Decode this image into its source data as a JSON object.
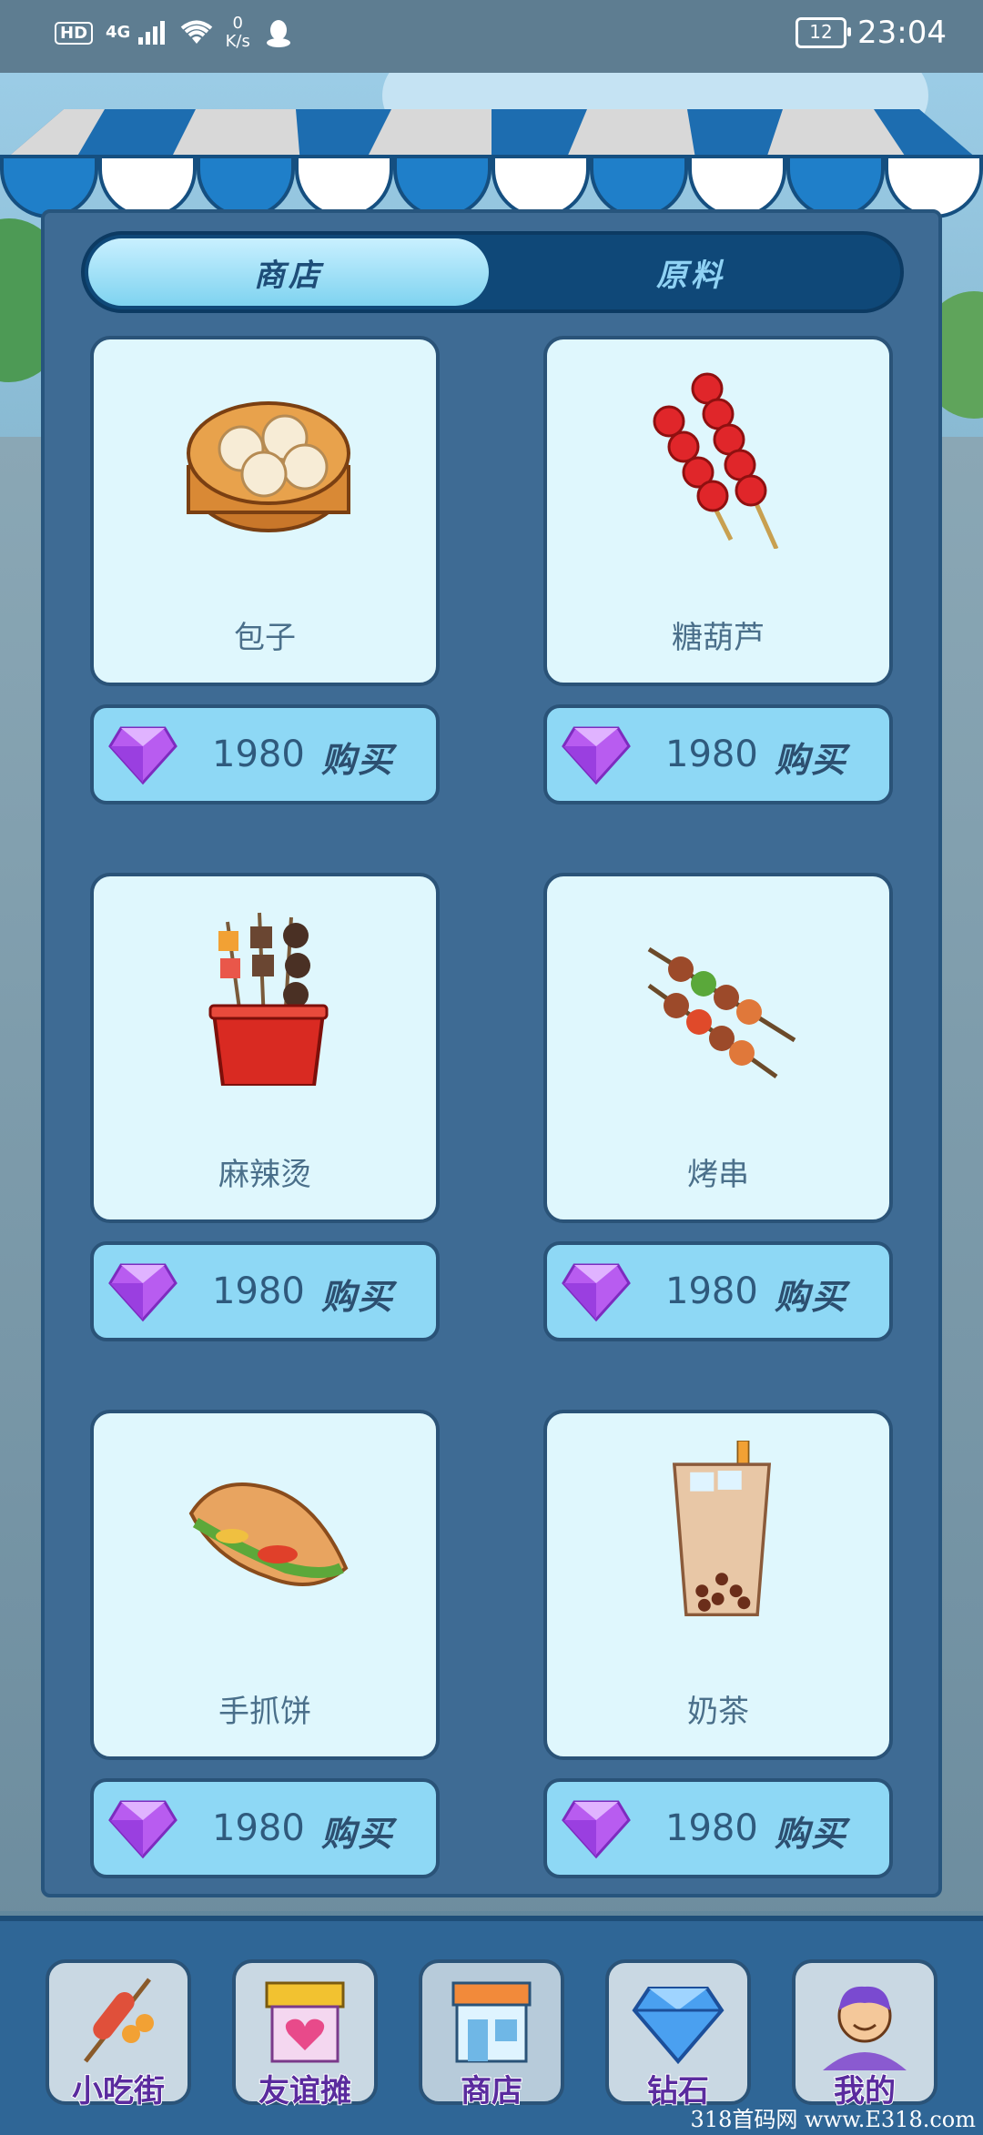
{
  "status_bar": {
    "hd": "HD",
    "network": "4G",
    "speed_value": "0",
    "speed_unit": "K/s",
    "battery": "12",
    "time": "23:04"
  },
  "tabs": [
    {
      "label": "商店",
      "active": true
    },
    {
      "label": "原料",
      "active": false
    }
  ],
  "items": [
    {
      "name": "包子",
      "price": "1980",
      "buy_label": "购买",
      "icon": "baozi-steamer"
    },
    {
      "name": "糖葫芦",
      "price": "1980",
      "buy_label": "购买",
      "icon": "candied-haws"
    },
    {
      "name": "麻辣烫",
      "price": "1980",
      "buy_label": "购买",
      "icon": "malatang-cup"
    },
    {
      "name": "烤串",
      "price": "1980",
      "buy_label": "购买",
      "icon": "kebab-skewers"
    },
    {
      "name": "手抓饼",
      "price": "1980",
      "buy_label": "购买",
      "icon": "pancake-wrap"
    },
    {
      "name": "奶茶",
      "price": "1980",
      "buy_label": "购买",
      "icon": "bubble-tea"
    }
  ],
  "bottom_nav": [
    {
      "label": "小吃街",
      "icon": "snack-skewer"
    },
    {
      "label": "友谊摊",
      "icon": "friend-stall"
    },
    {
      "label": "商店",
      "icon": "shop",
      "active": true
    },
    {
      "label": "钻石",
      "icon": "diamond"
    },
    {
      "label": "我的",
      "icon": "avatar"
    }
  ],
  "watermark": "318首码网 www.E318.com",
  "colors": {
    "panel": "#3e6b94",
    "card": "#dff7fd",
    "buy_bg": "#8ed8f5",
    "gem": "#b85cf0",
    "nav_label": "#5a2b9e"
  }
}
